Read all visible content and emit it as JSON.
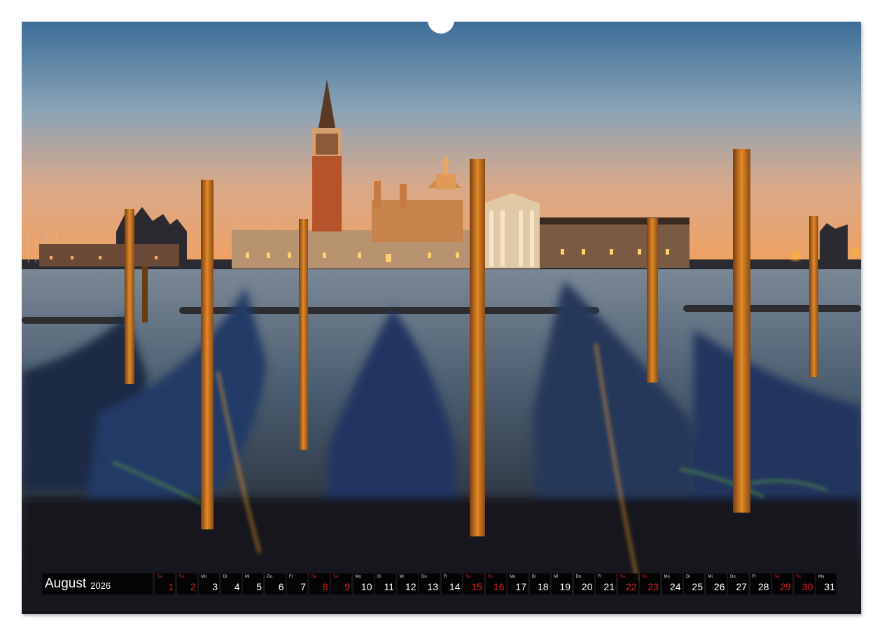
{
  "calendar": {
    "month": "August",
    "year": "2026",
    "days": [
      {
        "wd": "Sa",
        "num": "1",
        "we": true
      },
      {
        "wd": "So",
        "num": "2",
        "we": true
      },
      {
        "wd": "Mo",
        "num": "3",
        "we": false
      },
      {
        "wd": "Di",
        "num": "4",
        "we": false
      },
      {
        "wd": "Mi",
        "num": "5",
        "we": false
      },
      {
        "wd": "Do",
        "num": "6",
        "we": false
      },
      {
        "wd": "Fr",
        "num": "7",
        "we": false
      },
      {
        "wd": "Sa",
        "num": "8",
        "we": true
      },
      {
        "wd": "So",
        "num": "9",
        "we": true
      },
      {
        "wd": "Mo",
        "num": "10",
        "we": false
      },
      {
        "wd": "Di",
        "num": "11",
        "we": false
      },
      {
        "wd": "Mi",
        "num": "12",
        "we": false
      },
      {
        "wd": "Do",
        "num": "13",
        "we": false
      },
      {
        "wd": "Fr",
        "num": "14",
        "we": false
      },
      {
        "wd": "Sa",
        "num": "15",
        "we": true
      },
      {
        "wd": "So",
        "num": "16",
        "we": true
      },
      {
        "wd": "Mo",
        "num": "17",
        "we": false
      },
      {
        "wd": "Di",
        "num": "18",
        "we": false
      },
      {
        "wd": "Mi",
        "num": "19",
        "we": false
      },
      {
        "wd": "Do",
        "num": "20",
        "we": false
      },
      {
        "wd": "Fr",
        "num": "21",
        "we": false
      },
      {
        "wd": "Sa",
        "num": "22",
        "we": true
      },
      {
        "wd": "So",
        "num": "23",
        "we": true
      },
      {
        "wd": "Mo",
        "num": "24",
        "we": false
      },
      {
        "wd": "Di",
        "num": "25",
        "we": false
      },
      {
        "wd": "Mi",
        "num": "26",
        "we": false
      },
      {
        "wd": "Do",
        "num": "27",
        "we": false
      },
      {
        "wd": "Fr",
        "num": "28",
        "we": false
      },
      {
        "wd": "Sa",
        "num": "29",
        "we": true
      },
      {
        "wd": "So",
        "num": "30",
        "we": true
      },
      {
        "wd": "Mo",
        "num": "31",
        "we": false
      }
    ]
  },
  "colors": {
    "weekend": "#e02020",
    "sky_top": "#3d6e98",
    "sky_horizon": "#f2a05c",
    "water": "#4b5d70",
    "pole": "#c9741c"
  }
}
